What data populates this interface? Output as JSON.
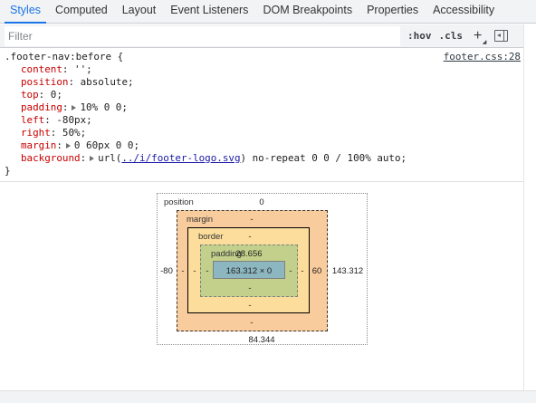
{
  "tabs": [
    "Styles",
    "Computed",
    "Layout",
    "Event Listeners",
    "DOM Breakpoints",
    "Properties",
    "Accessibility"
  ],
  "toolbar": {
    "filter_placeholder": "Filter",
    "hov_label": ":hov",
    "cls_label": ".cls",
    "plus_label": "+"
  },
  "rule": {
    "selector": ".footer-nav:before {",
    "source": "footer.css:28",
    "close": "}",
    "properties": [
      {
        "name": "content",
        "value": "'';"
      },
      {
        "name": "position",
        "value": "absolute;"
      },
      {
        "name": "top",
        "value": "0;"
      },
      {
        "name": "padding",
        "value": "10% 0 0;"
      },
      {
        "name": "left",
        "value": "-80px;"
      },
      {
        "name": "right",
        "value": "50%;"
      },
      {
        "name": "margin",
        "value": "0 60px 0 0;"
      },
      {
        "name": "background",
        "value_prefix": "url(",
        "url": "../i/footer-logo.svg",
        "value_suffix": ") no-repeat 0 0 / 100% auto;"
      }
    ]
  },
  "boxmodel": {
    "position_label": "position",
    "position_top": "0",
    "position_left": "-80",
    "position_right": "143.312",
    "position_bottom": "84.344",
    "margin_label": "margin",
    "margin_top": "-",
    "margin_left": "-",
    "margin_right": "60",
    "margin_bottom": "-",
    "border_label": "border",
    "border_top": "-",
    "border_left": "-",
    "border_right": "-",
    "border_bottom": "-",
    "padding_label": "padding",
    "padding_top": "28.656",
    "padding_left": "-",
    "padding_right": "-",
    "padding_bottom": "-",
    "content_size": "163.312 × 0"
  }
}
